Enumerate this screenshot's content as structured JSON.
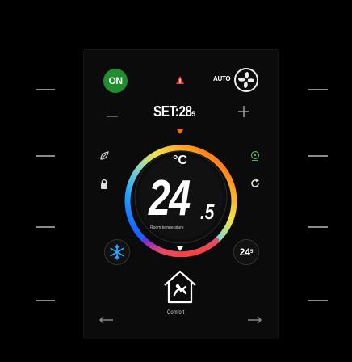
{
  "power": {
    "label": "ON"
  },
  "mode": {
    "label": "AUTO"
  },
  "setpoint": {
    "label": "SET:28",
    "decimal": "5"
  },
  "room": {
    "temp_int": "24",
    "temp_dec": ".5",
    "unit": "°C",
    "label": "Room temperature"
  },
  "quick_temp": {
    "int": "24",
    "dec": "5"
  },
  "scene": {
    "label": "Comfort"
  },
  "colors": {
    "on": "#1f8e2e",
    "alarm": "#e53935",
    "marker": "#ff6a00",
    "cool_icon": "#2ea8ff",
    "fan_icon": "#4caf50"
  },
  "icons": [
    "alarm-icon",
    "fan-icon",
    "minus-icon",
    "plus-icon",
    "eco-icon",
    "lock-icon",
    "fan-speed-icon",
    "cycle-icon",
    "snowflake-icon",
    "home-comfort-icon",
    "arrow-left-icon",
    "arrow-right-icon"
  ]
}
